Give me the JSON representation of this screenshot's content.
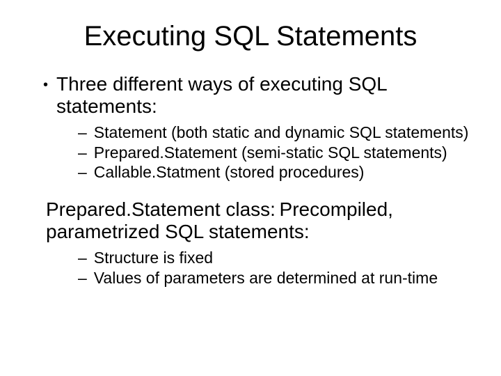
{
  "title": "Executing SQL Statements",
  "bullets": {
    "b1": "Three different ways of executing SQL statements:",
    "b1_children": {
      "c1": "Statement (both static and dynamic SQL statements)",
      "c2": "Prepared.Statement (semi-static SQL statements)",
      "c3": "Callable.Statment (stored procedures)"
    },
    "p2": "Prepared.Statement class: Precompiled, parametrized SQL statements:",
    "p2_children": {
      "c1": "Structure is fixed",
      "c2": "Values of parameters are determined at run-time"
    }
  }
}
